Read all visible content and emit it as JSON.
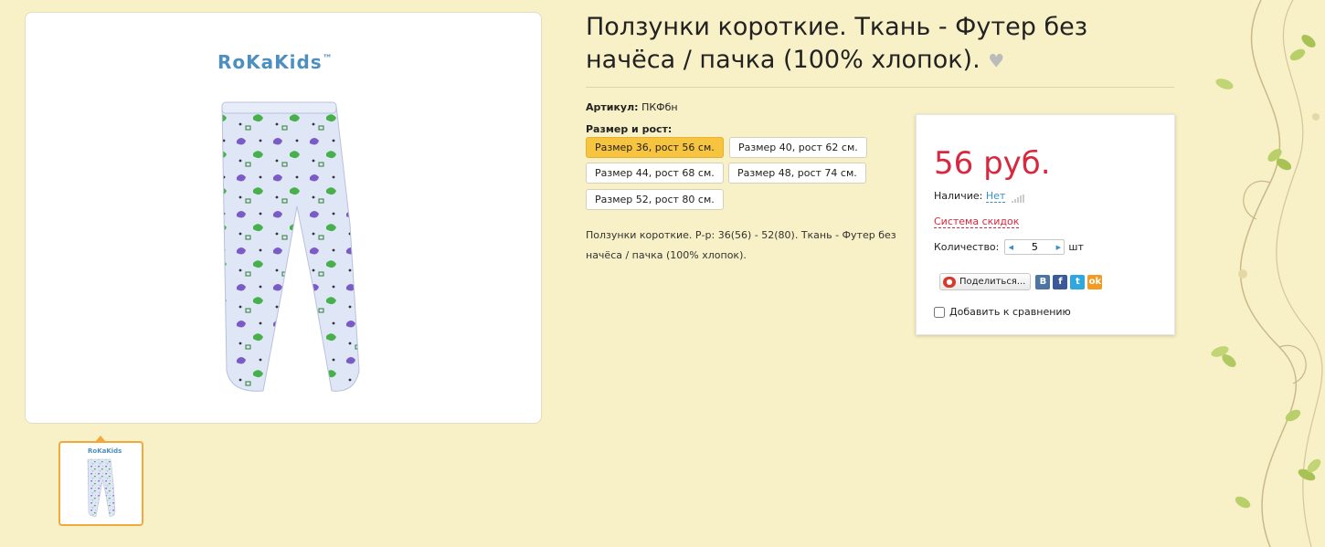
{
  "brand": {
    "name": "RoKaKids",
    "tm": "™"
  },
  "product": {
    "title": "Ползунки короткие. Ткань - Футер без начёса / пачка (100% хлопок).",
    "favorite_icon": "heart-icon",
    "article_label": "Артикул:",
    "article_value": "ПКФбн",
    "size_label": "Размер и рост:",
    "sizes": [
      {
        "label": "Размер 36, рост 56 см.",
        "active": true
      },
      {
        "label": "Размер 40, рост 62 см.",
        "active": false
      },
      {
        "label": "Размер 44, рост 68 см.",
        "active": false
      },
      {
        "label": "Размер 48, рост 74 см.",
        "active": false
      },
      {
        "label": "Размер 52, рост 80 см.",
        "active": false
      }
    ],
    "description": "Ползунки короткие. Р-р: 36(56) - 52(80). Ткань - Футер без начёса / пачка (100% хлопок)."
  },
  "buy_box": {
    "price": "56 руб.",
    "availability_label": "Наличие:",
    "availability_value": "Нет",
    "discount_link": "Система скидок",
    "quantity_label": "Количество:",
    "quantity_value": "5",
    "quantity_unit": "шт",
    "share_label": "Поделиться...",
    "social": [
      "В",
      "f",
      "t",
      "ok"
    ],
    "compare_label": "Добавить к сравнению"
  },
  "colors": {
    "background": "#f8f0c6",
    "price": "#d7283f",
    "accent": "#f6c43f",
    "link": "#3a8fc7"
  }
}
